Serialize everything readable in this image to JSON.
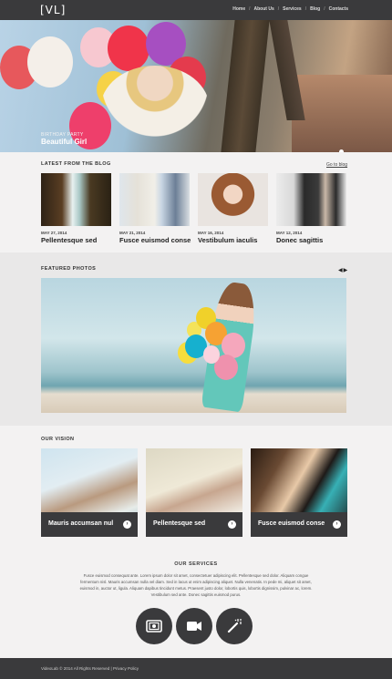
{
  "header": {
    "logo": "[VL]",
    "nav": [
      "Home",
      "About Us",
      "Services",
      "Blog",
      "Contacts"
    ]
  },
  "hero": {
    "caption_small": "BIRTHDAY PARTY",
    "caption_title": "Beautiful Girl",
    "slides": 2,
    "active_slide": 1
  },
  "blog": {
    "heading": "LATEST FROM THE BLOG",
    "link": "Go to blog",
    "posts": [
      {
        "date": "MAY 27, 2014",
        "title": "Pellentesque sed"
      },
      {
        "date": "MAY 21, 2014",
        "title": "Fusce euismod conse"
      },
      {
        "date": "MAY 16, 2014",
        "title": "Vestibulum iaculis"
      },
      {
        "date": "MAY 12, 2014",
        "title": "Donec sagittis"
      }
    ]
  },
  "photos": {
    "heading": "FEATURED PHOTOS",
    "prev": "◀",
    "next": "▶"
  },
  "vision": {
    "heading": "OUR VISION",
    "cards": [
      {
        "label": "Mauris accumsan nul"
      },
      {
        "label": "Pellentesque sed"
      },
      {
        "label": "Fusce euismod conse"
      }
    ]
  },
  "services": {
    "heading": "OUR SERVICES",
    "text": "Fusce euismod consequat ante. Lorem ipsum dolor sit amet, consectetuer adipiscing elit. Pellentesque sed dolor. Aliquam congue fermentum nisl. Mauris accumsan nulla vel diam. Sed in lacus ut enim adipiscing aliquet. Nulla venenatis. In pede mi, aliquet sit amet, euismod in, auctor ut, ligula. Aliquam dapibus tincidunt metus. Praesent justo dolor, lobortis quis, lobortis dignissim, pulvinar ac, lorem. Vestibulum sed ante. Donec sagittis euismod purus.",
    "icons": [
      "photo-icon",
      "video-camera-icon",
      "magic-wand-icon"
    ]
  },
  "footer": {
    "text": "VideoLab © 2014 All Rights Reserved  |  Privacy Policy"
  }
}
